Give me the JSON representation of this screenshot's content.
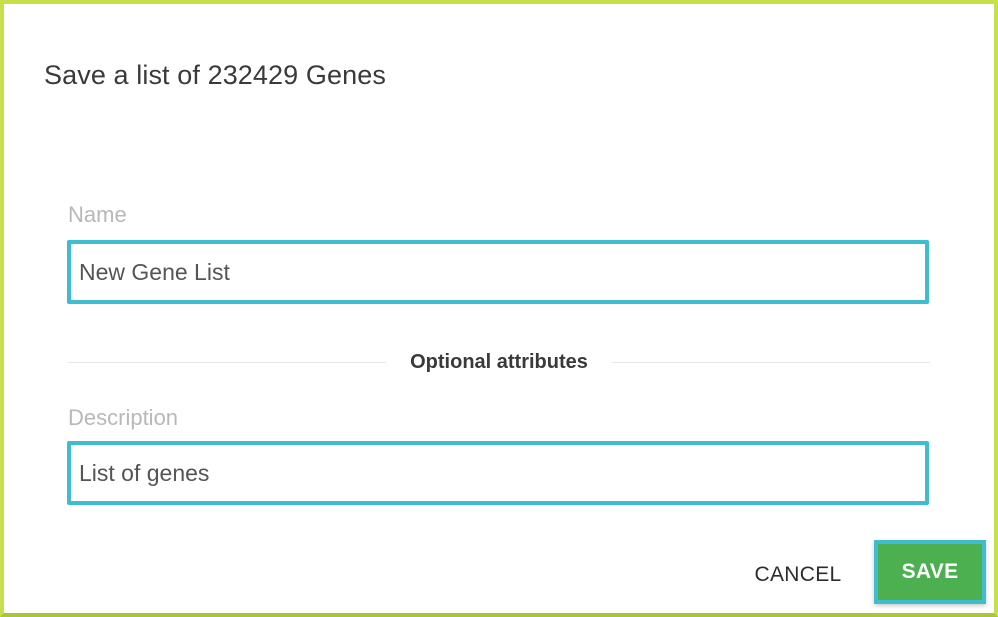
{
  "dialog": {
    "title": "Save a list of 232429 Genes"
  },
  "form": {
    "name_label": "Name",
    "name_value": "New Gene List",
    "optional_heading": "Optional attributes",
    "description_label": "Description",
    "description_value": "List of genes"
  },
  "actions": {
    "cancel_label": "CANCEL",
    "save_label": "SAVE"
  },
  "colors": {
    "focus_border": "#3fbccd",
    "save_bg": "#4caf50",
    "frame_border": "#c5e04a"
  }
}
